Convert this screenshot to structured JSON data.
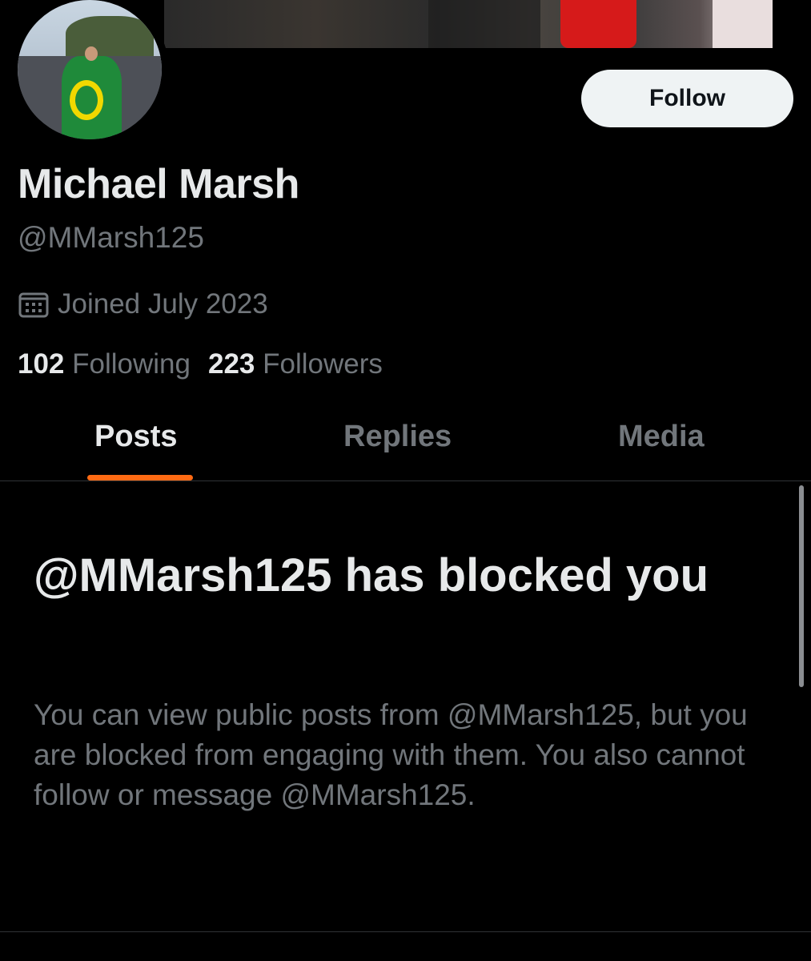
{
  "profile": {
    "display_name": "Michael Marsh",
    "handle": "@MMarsh125",
    "joined": "Joined July 2023",
    "following_count": "102",
    "following_label": "Following",
    "followers_count": "223",
    "followers_label": "Followers",
    "follow_button_label": "Follow"
  },
  "tabs": [
    {
      "label": "Posts",
      "active": true
    },
    {
      "label": "Replies",
      "active": false
    },
    {
      "label": "Media",
      "active": false
    }
  ],
  "blocked": {
    "title": "@MMarsh125 has blocked you",
    "body": "You can view public posts from @MMarsh125, but you are blocked from engaging with them. You also cannot follow or message @MMarsh125."
  },
  "colors": {
    "accent": "#ff6a13",
    "background": "#000000",
    "primary_text": "#e7e9ea",
    "secondary_text": "#71767b",
    "button_bg": "#eff3f4"
  },
  "icons": {
    "joined": "calendar-icon"
  }
}
